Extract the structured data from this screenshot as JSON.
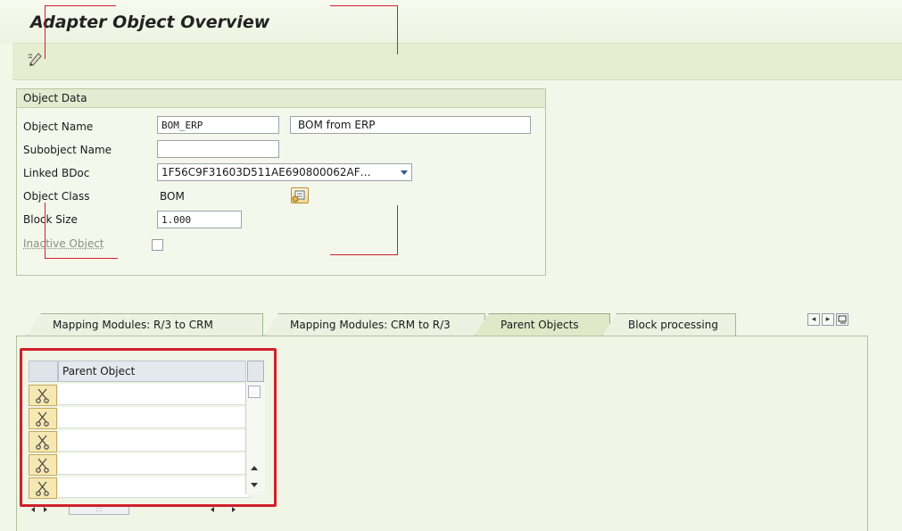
{
  "window": {
    "title": "Adapter Object Overview"
  },
  "toolbar": {
    "edit_icon": "display-change-icon"
  },
  "object_data": {
    "group_title": "Object Data",
    "object_name": {
      "label": "Object Name",
      "value": "BOM_ERP",
      "description": "BOM from ERP"
    },
    "subobject_name": {
      "label": "Subobject Name",
      "value": ""
    },
    "linked_bdoc": {
      "label": "Linked BDoc",
      "value": "1F56C9F31603D511AE690800062AF…"
    },
    "object_class": {
      "label": "Object Class",
      "value": "BOM"
    },
    "block_size": {
      "label": "Block Size",
      "value": "1.000"
    },
    "inactive_object": {
      "label": "Inactive Object",
      "checked": false
    }
  },
  "tabs": [
    {
      "label": "Mapping Modules: R/3 to CRM",
      "active": false
    },
    {
      "label": "Mapping Modules: CRM to R/3",
      "active": false
    },
    {
      "label": "Parent Objects",
      "active": true
    },
    {
      "label": "Block processing",
      "active": false
    }
  ],
  "parent_table": {
    "column_header": "Parent Object",
    "rows": [
      "",
      "",
      "",
      "",
      ""
    ],
    "row_icon": "scissors-icon"
  },
  "colors": {
    "highlight": "#d0202a",
    "background": "#f3f7ea"
  }
}
